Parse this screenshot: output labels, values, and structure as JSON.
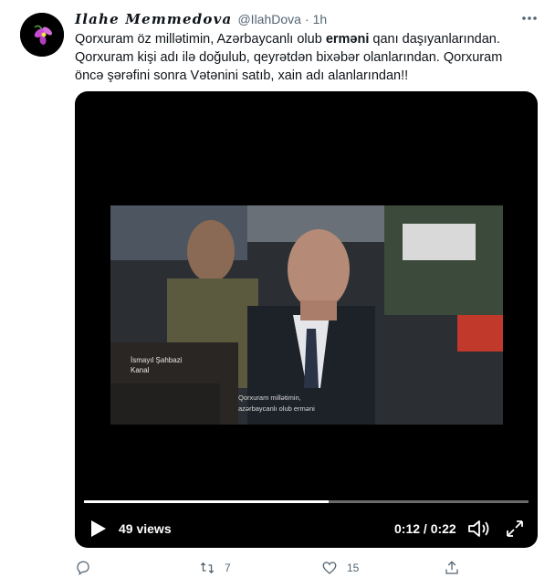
{
  "tweet": {
    "display_name": "Ilahe Memmedova",
    "handle": "@IlahDova",
    "separator": "·",
    "time": "1h",
    "text_part1": "Qorxuram öz millətimin, Azərbaycanlı olub ",
    "text_bold": "erməni",
    "text_part2": " qanı daşıyanlarından. Qorxuram kişi adı ilə doğulub, qeyrətdən bixəbər olanlarından. Qorxuram öncə şərəfini sonra Vətənini satıb, xain adı alanlarından!!"
  },
  "video": {
    "caption_name": "İsmayıl Şahbazi",
    "caption_role": "Kanal",
    "subtitle_line1": "Qorxuram millətimin,",
    "subtitle_line2": "azərbaycanlı olub erməni",
    "views": "49 views",
    "time": "0:12 / 0:22",
    "progress": 0.55
  },
  "actions": {
    "reply_count": "",
    "retweet_count": "7",
    "like_count": "15"
  },
  "colors": {
    "accent": "#1d9bf0",
    "text": "#0f1419",
    "muted": "#536471"
  }
}
